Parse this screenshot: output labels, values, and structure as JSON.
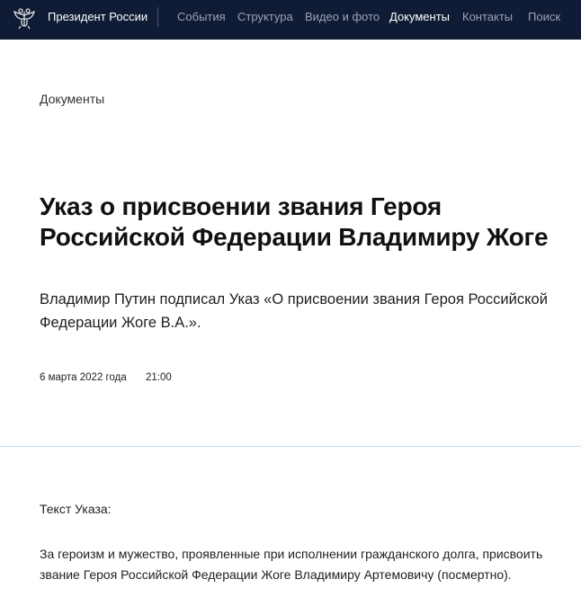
{
  "header": {
    "site_title": "Президент России",
    "nav": [
      "События",
      "Структура",
      "Видео и фото",
      "Документы",
      "Контакты",
      "Поиск"
    ],
    "active_nav": "Документы",
    "emblem_icon": "double-headed-eagle-icon",
    "background_color": "#101c35"
  },
  "breadcrumb": "Документы",
  "article": {
    "title": "Указ о присвоении звания Героя Российской Федерации Владимиру Жоге",
    "lead": "Владимир Путин подписал Указ «О присвоении звания Героя Российской Федерации Жоге В.А.».",
    "date": "6 марта 2022 года",
    "time": "21:00"
  },
  "content": {
    "section_label": "Текст Указа:",
    "body": "За героизм и мужество, проявленные при исполнении гражданского долга, присвоить звание Героя Российской Федерации Жоге Владимиру Артемовичу (посмертно)."
  }
}
